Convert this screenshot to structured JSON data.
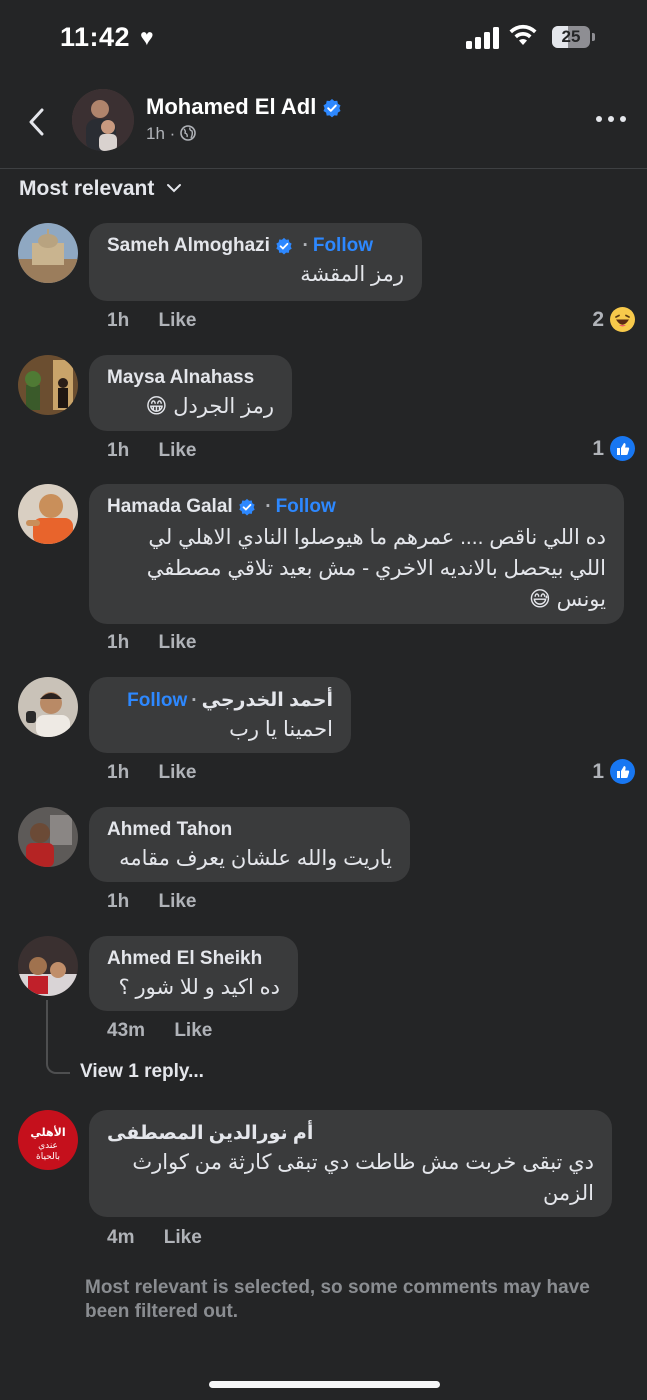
{
  "status_bar": {
    "time": "11:42",
    "battery": "25"
  },
  "post": {
    "author": "Mohamed El Adl",
    "time": "1h",
    "privacy_icon": "globe-icon"
  },
  "sort": {
    "label": "Most relevant"
  },
  "comments": [
    {
      "author": "Sameh Almoghazi",
      "follow": "Follow",
      "text": "رمز المقشة",
      "time": "1h",
      "like": "Like",
      "reaction_count": "2",
      "reaction": "haha"
    },
    {
      "author": "Maysa Alnahass",
      "text": "رمز الجردل 😁",
      "time": "1h",
      "like": "Like",
      "reaction_count": "1",
      "reaction": "like"
    },
    {
      "author": "Hamada Galal",
      "follow": "Follow",
      "text": "ده اللي ناقص .... عمرهم ما هيوصلوا النادي الاهلي لي اللي بيحصل بالانديه الاخري - مش بعيد تلاقي مصطفي يونس 😅",
      "time": "1h",
      "like": "Like"
    },
    {
      "author": "أحمد الخدرجي",
      "follow": "Follow",
      "text": "احمينا يا رب",
      "time": "1h",
      "like": "Like",
      "reaction_count": "1",
      "reaction": "like"
    },
    {
      "author": "Ahmed Tahon",
      "text": "ياريت والله علشان يعرف مقامه",
      "time": "1h",
      "like": "Like"
    },
    {
      "author": "Ahmed El Sheikh",
      "text": "ده اكيد و للا شور ؟",
      "time": "43m",
      "like": "Like",
      "replies": "View 1 reply..."
    },
    {
      "author": "أم نورالدين المصطفى",
      "text": "دي تبقى خربت مش ظاطت دي تبقى كارثة من كوارث الزمن",
      "time": "4m",
      "like": "Like"
    }
  ],
  "filter_note": "Most relevant is selected, so some comments may have been filtered out.",
  "colors": {
    "background": "#242526",
    "bubble": "#3a3b3c",
    "accent": "#2d88ff",
    "muted": "#b0b3b8"
  }
}
